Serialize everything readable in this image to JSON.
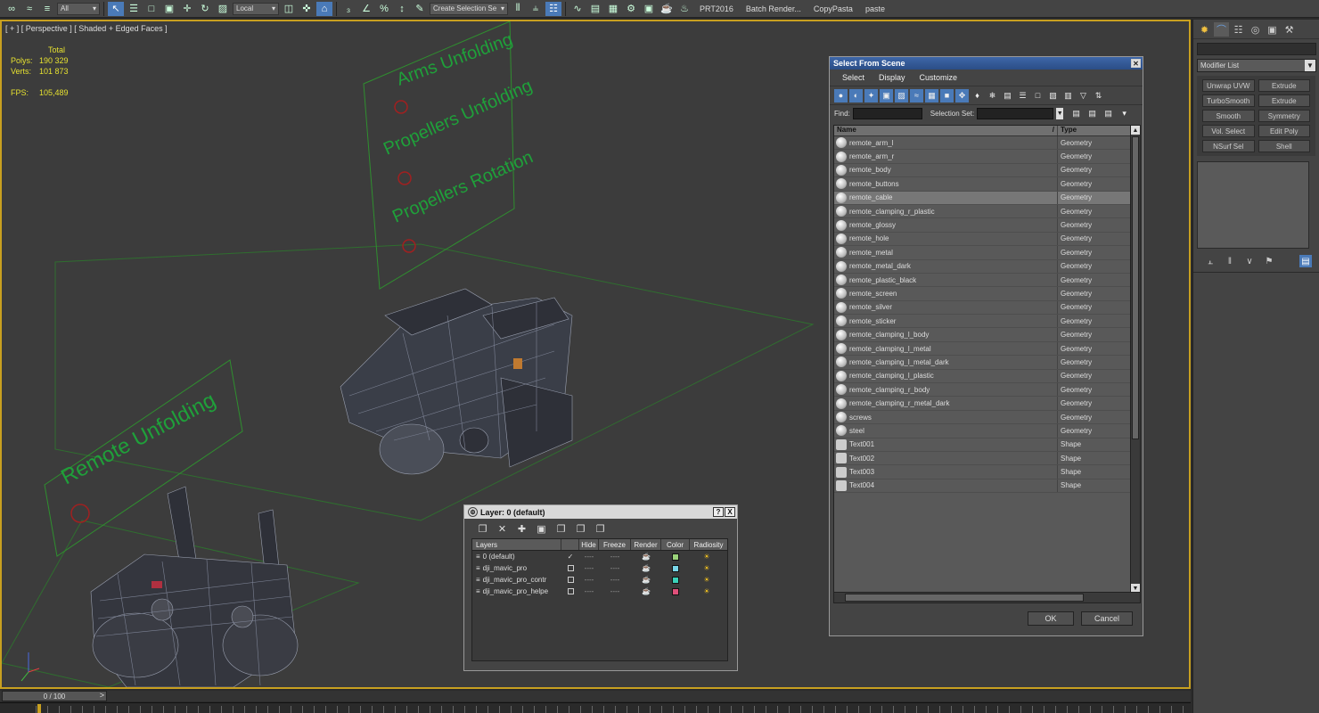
{
  "toolbar": {
    "selection_filter": "All",
    "ref_coord": "Local",
    "named_set_placeholder": "Create Selection Se",
    "plugins": [
      "PRT2016",
      "Batch Render...",
      "CopyPasta",
      "paste"
    ]
  },
  "viewport": {
    "label": "[ + ] [ Perspective ] [ Shaded + Edged Faces ]",
    "stats": {
      "header": "Total",
      "polys_label": "Polys:",
      "polys_value": "190 329",
      "verts_label": "Verts:",
      "verts_value": "101 873",
      "fps_label": "FPS:",
      "fps_value": "105,489"
    },
    "scene_texts": {
      "arms": "Arms Unfolding",
      "propellers": "Propellers Unfolding",
      "rotation": "Propellers Rotation",
      "remote": "Remote Unfolding"
    }
  },
  "timeline": {
    "slider_label": "0 / 100",
    "next_arrow": ">"
  },
  "command_panel": {
    "modifier_list": "Modifier List",
    "buttons": [
      "Unwrap UVW",
      "Extrude",
      "TurboSmooth",
      "Extrude",
      "Smooth",
      "Symmetry",
      "Vol. Select",
      "Edit Poly",
      "NSurf Sel",
      "Shell"
    ]
  },
  "select_from_scene": {
    "title": "Select From Scene",
    "menu": [
      "Select",
      "Display",
      "Customize"
    ],
    "find_label": "Find:",
    "selection_set_label": "Selection Set:",
    "col_name": "Name",
    "col_type": "Type",
    "rows": [
      {
        "name": "remote_arm_l",
        "type": "Geometry"
      },
      {
        "name": "remote_arm_r",
        "type": "Geometry"
      },
      {
        "name": "remote_body",
        "type": "Geometry"
      },
      {
        "name": "remote_buttons",
        "type": "Geometry"
      },
      {
        "name": "remote_cable",
        "type": "Geometry"
      },
      {
        "name": "remote_clamping_r_plastic",
        "type": "Geometry"
      },
      {
        "name": "remote_glossy",
        "type": "Geometry"
      },
      {
        "name": "remote_hole",
        "type": "Geometry"
      },
      {
        "name": "remote_metal",
        "type": "Geometry"
      },
      {
        "name": "remote_metal_dark",
        "type": "Geometry"
      },
      {
        "name": "remote_plastic_black",
        "type": "Geometry"
      },
      {
        "name": "remote_screen",
        "type": "Geometry"
      },
      {
        "name": "remote_silver",
        "type": "Geometry"
      },
      {
        "name": "remote_sticker",
        "type": "Geometry"
      },
      {
        "name": "remote_clamping_l_body",
        "type": "Geometry"
      },
      {
        "name": "remote_clamping_l_metal",
        "type": "Geometry"
      },
      {
        "name": "remote_clamping_l_metal_dark",
        "type": "Geometry"
      },
      {
        "name": "remote_clamping_l_plastic",
        "type": "Geometry"
      },
      {
        "name": "remote_clamping_r_body",
        "type": "Geometry"
      },
      {
        "name": "remote_clamping_r_metal_dark",
        "type": "Geometry"
      },
      {
        "name": "screws",
        "type": "Geometry"
      },
      {
        "name": "steel",
        "type": "Geometry"
      },
      {
        "name": "Text001",
        "type": "Shape"
      },
      {
        "name": "Text002",
        "type": "Shape"
      },
      {
        "name": "Text003",
        "type": "Shape"
      },
      {
        "name": "Text004",
        "type": "Shape"
      }
    ],
    "selected_row": "remote_cable",
    "ok_label": "OK",
    "cancel_label": "Cancel"
  },
  "layer_dialog": {
    "title": "Layer: 0 (default)",
    "help": "?",
    "close": "X",
    "columns": [
      "Layers",
      "",
      "Hide",
      "Freeze",
      "Render",
      "Color",
      "Radiosity"
    ],
    "layers": [
      {
        "name": "0 (default)",
        "current": true,
        "color": "#9ad27a"
      },
      {
        "name": "dji_mavic_pro",
        "current": false,
        "color": "#7ad6e8"
      },
      {
        "name": "dji_mavic_pro_contr",
        "current": false,
        "color": "#3ad0b8"
      },
      {
        "name": "dji_mavic_pro_helpe",
        "current": false,
        "color": "#e0507a"
      }
    ],
    "dash": "----"
  }
}
